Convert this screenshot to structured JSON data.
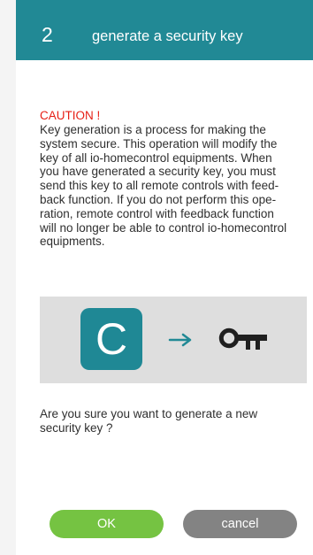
{
  "header": {
    "step_number": "2",
    "title": "generate a security key"
  },
  "caution": {
    "title": "CAUTION !",
    "text": "Key generation is a process for making the\nsystem secure. This operation will modify the\nkey of all io-homecontrol equipments. When\nyou have generated a security key, you must\nsend this key to all remote controls with feed-\nback function.  If you do not perform this ope-\nration, remote control with feedback function\nwill no longer be able to control io-homecontrol\nequipments."
  },
  "illustration": {
    "app_letter": "C",
    "icons": [
      "app-icon",
      "arrow-icon",
      "key-icon"
    ],
    "colors": {
      "app_background": "#1f8895",
      "arrow": "#218995",
      "key": "#1f1f1f",
      "panel": "#dedede"
    }
  },
  "question": "Are you sure you want to generate a new\nsecurity key ?",
  "buttons": {
    "ok": "OK",
    "cancel": "cancel"
  },
  "colors": {
    "header": "#218995",
    "caution": "#e61e14",
    "ok_button": "#75c342",
    "cancel_button": "#838383"
  }
}
